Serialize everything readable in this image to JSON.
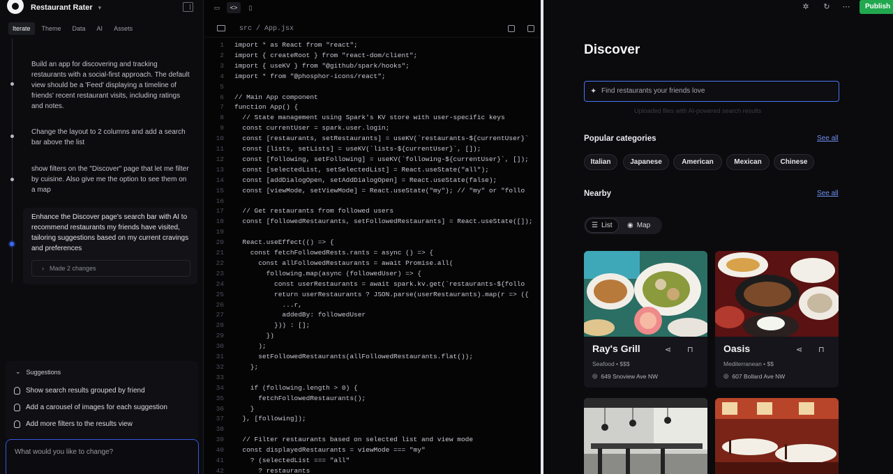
{
  "app": {
    "title": "Restaurant Rater"
  },
  "tabs": [
    "Iterate",
    "Theme",
    "Data",
    "AI",
    "Assets"
  ],
  "timeline": [
    {
      "text": "Build an app for discovering and tracking restaurants with a social-first approach. The default view should be a 'Feed' displaying a timeline of friends' recent restaurant visits, including ratings and notes."
    },
    {
      "text": "Change the layout to 2 columns and add a search bar above the list"
    },
    {
      "text": "show filters on the \"Discover\" page that let me filter by cuisine. Also give me the option to see them on a map"
    },
    {
      "text": "Enhance the Discover page's search bar with AI to recommend restaurants my friends have visited, tailoring suggestions based on my current cravings and preferences"
    }
  ],
  "changes_label": "Made 2 changes",
  "suggestions": {
    "heading": "Suggestions",
    "items": [
      "Show search results grouped by friend",
      "Add a carousel of images for each suggestion",
      "Add more filters to the results view"
    ]
  },
  "prompt": {
    "placeholder": "What would you like to change?"
  },
  "code": {
    "file_path": "src / App.jsx",
    "start_line": 1,
    "lines": [
      "import * as React from \"react\";",
      "import { createRoot } from \"react-dom/client\";",
      "import { useKV } from \"@github/spark/hooks\";",
      "import * from \"@phosphor-icons/react\";",
      "",
      "// Main App component",
      "function App() {",
      "  // State management using Spark's KV store with user-specific keys",
      "  const currentUser = spark.user.login;",
      "  const [restaurants, setRestaurants] = useKV(`restaurants-${currentUser}`",
      "  const [lists, setLists] = useKV(`lists-${currentUser}`, []);",
      "  const [following, setFollowing] = useKV(`following-${currentUser}`, []);",
      "  const [selectedList, setSelectedList] = React.useState(\"all\");",
      "  const [addDialogOpen, setAddDialogOpen] = React.useState(false);",
      "  const [viewMode, setViewMode] = React.useState(\"my\"); // \"my\" or \"follo",
      "",
      "  // Get restaurants from followed users",
      "  const [followedRestaurants, setFollowedRestaurants] = React.useState([]);",
      "",
      "  React.useEffect(() => {",
      "    const fetchFollowedRests.rants = async () => {",
      "      const allFollowedRestaurants = await Promise.all(",
      "        following.map(async (followedUser) => {",
      "          const userRestaurants = await spark.kv.get(`restaurants-${follo",
      "          return userRestaurants ? JSON.parse(userRestaurants).map(r => ({",
      "            ...r,",
      "            addedBy: followedUser",
      "          })) : [];",
      "        })",
      "      );",
      "      setFollowedRestaurants(allFollowedRestaurants.flat());",
      "    };",
      "",
      "    if (following.length > 0) {",
      "      fetchFollowedRestaurants();",
      "    }",
      "  }, [following]);",
      "",
      "  // Filter restaurants based on selected list and view mode",
      "  const displayedRestaurants = viewMode === \"my\"",
      "    ? (selectedList === \"all\"",
      "      ? restaurants"
    ]
  },
  "preview": {
    "publish_label": "Publish",
    "title": "Discover",
    "search_placeholder": "Find restaurants your friends love",
    "search_hint": "Uploaded files with AI-powered search results",
    "popular_heading": "Popular categories",
    "nearby_heading": "Nearby",
    "see_all": "See all",
    "categories": [
      "Italian",
      "Japanese",
      "American",
      "Mexican",
      "Chinese"
    ],
    "view_toggle": {
      "list": "List",
      "map": "Map",
      "selected": "list"
    },
    "restaurants": [
      {
        "name": "Ray's Grill",
        "meta": "Seafood • $$$",
        "address": "649 Snoview Ave NW"
      },
      {
        "name": "Oasis",
        "meta": "Mediterranean • $$",
        "address": "607 Bollard Ave NW"
      },
      {
        "name": "",
        "meta": "",
        "address": ""
      },
      {
        "name": "",
        "meta": "",
        "address": ""
      }
    ]
  },
  "colors": {
    "accent": "#3d6cf0",
    "publish": "#21a84e",
    "link": "#6f8ff0"
  }
}
